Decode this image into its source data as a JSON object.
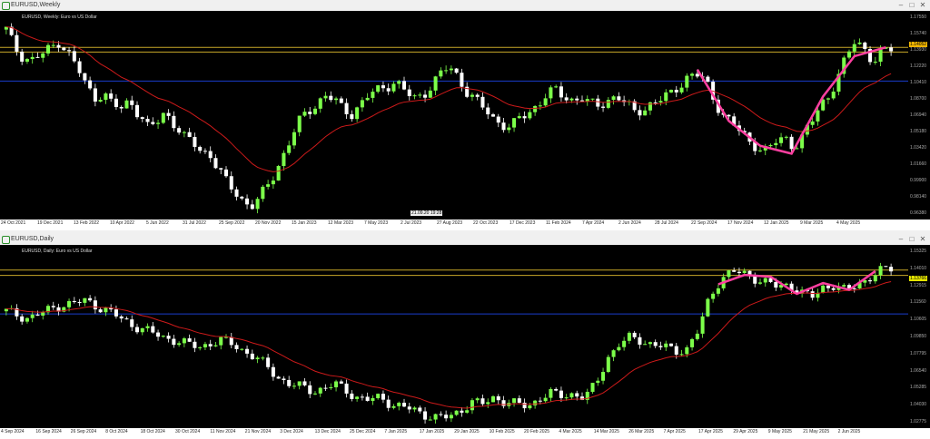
{
  "colors": {
    "bull": "#7cff4a",
    "bear": "#ffffff",
    "ma": "#cc1a1a",
    "pattern": "#ff3fa0",
    "hline_gold": "#c8a828",
    "hline_blue": "#1a3ccc"
  },
  "weekly": {
    "window_title": "EURUSD,Weekly",
    "symbol_label": "EURUSD, Weekly: Euro vs US Dollar",
    "price_badge": "1.14052",
    "x_ticks": [
      "24 Oct 2021",
      "19 Dec 2021",
      "13 Feb 2022",
      "10 Apr 2022",
      "5 Jun 2022",
      "31 Jul 2022",
      "25 Sep 2022",
      "20 Nov 2022",
      "15 Jan 2023",
      "12 Mar 2023",
      "7 May 2023",
      "2 Jul 2023",
      "27 Aug 2023",
      "22 Oct 2023",
      "17 Dec 2023",
      "11 Feb 2024",
      "7 Apr 2024",
      "2 Jun 2024",
      "28 Jul 2024",
      "22 Sep 2024",
      "17 Nov 2024",
      "12 Jan 2025",
      "9 Mar 2025",
      "4 May 2025"
    ],
    "y_ticks": [
      "1.17550",
      "1.15740",
      "1.13930",
      "1.12220",
      "1.10410",
      "1.08700",
      "1.06940",
      "1.05180",
      "1.03420",
      "1.01660",
      "0.99900",
      "0.98140",
      "0.96380"
    ],
    "tooltip": "21.09.20  19:28"
  },
  "daily": {
    "window_title": "EURUSD,Daily",
    "symbol_label": "EURUSD, Daily: Euro vs US Dollar",
    "price_badge": "1.13766",
    "x_ticks": [
      "4 Sep 2024",
      "16 Sep 2024",
      "26 Sep 2024",
      "8 Oct 2024",
      "18 Oct 2024",
      "30 Oct 2024",
      "11 Nov 2024",
      "21 Nov 2024",
      "3 Dec 2024",
      "13 Dec 2024",
      "25 Dec 2024",
      "7 Jan 2025",
      "17 Jan 2025",
      "29 Jan 2025",
      "10 Feb 2025",
      "20 Feb 2025",
      "4 Mar 2025",
      "14 Mar 2025",
      "26 Mar 2025",
      "7 Apr 2025",
      "17 Apr 2025",
      "29 Apr 2025",
      "9 May 2025",
      "21 May 2025",
      "2 Jun 2025"
    ],
    "y_ticks": [
      "1.15325",
      "1.14010",
      "1.12915",
      "1.11560",
      "1.10605",
      "1.09850",
      "1.07795",
      "1.06540",
      "1.05285",
      "1.04030",
      "1.02775"
    ]
  },
  "chart_data": [
    {
      "type": "candlestick",
      "title": "EURUSD, Weekly: Euro vs US Dollar",
      "timeframe": "Weekly",
      "ylim": [
        0.957,
        1.18
      ],
      "horizontal_lines": {
        "gold": [
          1.141,
          1.136
        ],
        "blue": [
          1.105
        ]
      },
      "x_range": [
        "24 Oct 2021",
        "4 May 2025"
      ],
      "series": [
        {
          "name": "close_path",
          "values": [
            1.16,
            1.14,
            1.13,
            1.128,
            1.133,
            1.14,
            1.148,
            1.135,
            1.12,
            1.1,
            1.088,
            1.092,
            1.08,
            1.075,
            1.085,
            1.07,
            1.055,
            1.06,
            1.072,
            1.06,
            1.045,
            1.04,
            1.03,
            1.028,
            1.01,
            0.995,
            0.985,
            0.975,
            0.972,
            0.985,
            1.0,
            1.02,
            1.04,
            1.06,
            1.072,
            1.08,
            1.09,
            1.085,
            1.075,
            1.07,
            1.08,
            1.09,
            1.095,
            1.1,
            1.105,
            1.095,
            1.085,
            1.09,
            1.1,
            1.112,
            1.12,
            1.11,
            1.095,
            1.085,
            1.075,
            1.065,
            1.06,
            1.055,
            1.065,
            1.07,
            1.08,
            1.09,
            1.095,
            1.088,
            1.085,
            1.088,
            1.08,
            1.078,
            1.085,
            1.09,
            1.08,
            1.072,
            1.075,
            1.082,
            1.085,
            1.09,
            1.1,
            1.11,
            1.112,
            1.105,
            1.085,
            1.07,
            1.06,
            1.05,
            1.04,
            1.035,
            1.03,
            1.04,
            1.045,
            1.035,
            1.045,
            1.06,
            1.08,
            1.09,
            1.11,
            1.13,
            1.15,
            1.14,
            1.125,
            1.135,
            1.14
          ]
        }
      ]
    },
    {
      "type": "candlestick",
      "title": "EURUSD, Daily: Euro vs US Dollar",
      "timeframe": "Daily",
      "ylim": [
        1.022,
        1.16
      ],
      "horizontal_lines": {
        "gold": [
          1.141,
          1.137
        ],
        "blue": [
          1.108
        ]
      },
      "x_range": [
        "4 Sep 2024",
        "2 Jun 2025"
      ],
      "series": [
        {
          "name": "close_path",
          "values": [
            1.11,
            1.107,
            1.105,
            1.108,
            1.112,
            1.115,
            1.116,
            1.118,
            1.114,
            1.11,
            1.105,
            1.1,
            1.097,
            1.093,
            1.09,
            1.088,
            1.085,
            1.083,
            1.086,
            1.088,
            1.085,
            1.08,
            1.075,
            1.068,
            1.06,
            1.055,
            1.053,
            1.05,
            1.052,
            1.055,
            1.05,
            1.045,
            1.043,
            1.045,
            1.04,
            1.038,
            1.035,
            1.032,
            1.03,
            1.03,
            1.035,
            1.042,
            1.04,
            1.045,
            1.042,
            1.04,
            1.038,
            1.045,
            1.048,
            1.046,
            1.048,
            1.045,
            1.055,
            1.075,
            1.085,
            1.09,
            1.088,
            1.085,
            1.083,
            1.08,
            1.082,
            1.095,
            1.12,
            1.135,
            1.14,
            1.138,
            1.135,
            1.132,
            1.128,
            1.13,
            1.125,
            1.12,
            1.128,
            1.13,
            1.125,
            1.13,
            1.135,
            1.14,
            1.142
          ]
        }
      ]
    }
  ]
}
